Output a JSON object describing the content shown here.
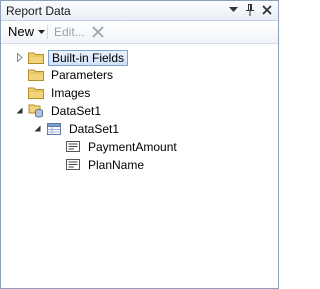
{
  "window": {
    "title": "Report Data"
  },
  "toolbar": {
    "new_label": "New",
    "edit_label": "Edit..."
  },
  "tree": {
    "builtin_fields": "Built-in Fields",
    "parameters": "Parameters",
    "images": "Images",
    "dataset_root": "DataSet1",
    "dataset_table": "DataSet1",
    "fields": [
      "PaymentAmount",
      "PlanName"
    ]
  },
  "colors": {
    "selection_border": "#7da2ce",
    "panel_border": "#8e9fbb"
  }
}
